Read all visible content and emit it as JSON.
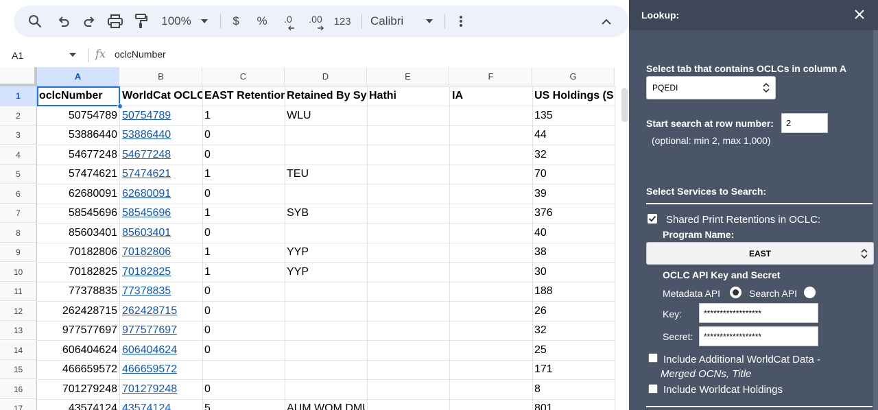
{
  "toolbar": {
    "zoom": "100%",
    "currency": "$",
    "percent": "%",
    "decrease_decimal": ".0",
    "increase_decimal": ".00",
    "number_format": "123",
    "font": "Calibri"
  },
  "formula_bar": {
    "cell_ref": "A1",
    "fx": "fx",
    "value": "oclcNumber"
  },
  "grid": {
    "columns": [
      "A",
      "B",
      "C",
      "D",
      "E",
      "F",
      "G"
    ],
    "row_numbers": [
      "1",
      "2",
      "3",
      "4",
      "5",
      "6",
      "7",
      "8",
      "9",
      "10",
      "11",
      "12",
      "13",
      "14",
      "15",
      "16",
      "17"
    ],
    "header_row": [
      "oclcNumber",
      "WorldCat OCLC",
      "EAST Retention",
      "Retained By Sy",
      "Hathi",
      "IA",
      "US Holdings (S"
    ],
    "rows": [
      [
        "50754789",
        "50754789",
        "1",
        "WLU",
        "",
        "",
        "135"
      ],
      [
        "53886440",
        "53886440",
        "0",
        "",
        "",
        "",
        "44"
      ],
      [
        "54677248",
        "54677248",
        "0",
        "",
        "",
        "",
        "32"
      ],
      [
        "57474621",
        "57474621",
        "1",
        "TEU",
        "",
        "",
        "70"
      ],
      [
        "62680091",
        "62680091",
        "0",
        "",
        "",
        "",
        "39"
      ],
      [
        "58545696",
        "58545696",
        "1",
        "SYB",
        "",
        "",
        "376"
      ],
      [
        "85603401",
        "85603401",
        "0",
        "",
        "",
        "",
        "40"
      ],
      [
        "70182806",
        "70182806",
        "1",
        "YYP",
        "",
        "",
        "38"
      ],
      [
        "70182825",
        "70182825",
        "1",
        "YYP",
        "",
        "",
        "30"
      ],
      [
        "77378835",
        "77378835",
        "0",
        "",
        "",
        "",
        "188"
      ],
      [
        "262428715",
        "262428715",
        "0",
        "",
        "",
        "",
        "26"
      ],
      [
        "977577697",
        "977577697",
        "0",
        "",
        "",
        "",
        "32"
      ],
      [
        "606404624",
        "606404624",
        "0",
        "",
        "",
        "",
        "25"
      ],
      [
        "466659572",
        "466659572",
        "",
        "",
        "",
        "",
        "171"
      ],
      [
        "701279248",
        "701279248",
        "0",
        "",
        "",
        "",
        "8"
      ],
      [
        "43574124",
        "43574124",
        "5",
        "AUM WOM DMU VZS MBR",
        "",
        "",
        "801"
      ]
    ]
  },
  "panel": {
    "title": "Lookup:",
    "tab_label": "Select tab that contains OCLCs in column A",
    "tab_value": "PQEDI",
    "start_row_label": "Start search at row number:",
    "start_row_value": "2",
    "start_row_hint": "(optional: min 2, max 1,000)",
    "services_label": "Select Services to Search:",
    "shared_print_label": "Shared Print Retentions in OCLC:",
    "program_name_label": "Program Name:",
    "program_name_value": "EAST",
    "api_key_label": "OCLC API Key and Secret",
    "metadata_api_label": "Metadata API",
    "search_api_label": "Search API",
    "key_label": "Key:",
    "key_value": "******************",
    "secret_label": "Secret:",
    "secret_value": "******************",
    "additional_data_label": "Include Additional WorldCat Data -",
    "additional_data_sub": "Merged OCNs, Title",
    "holdings_label": "Include Worldcat Holdings"
  }
}
